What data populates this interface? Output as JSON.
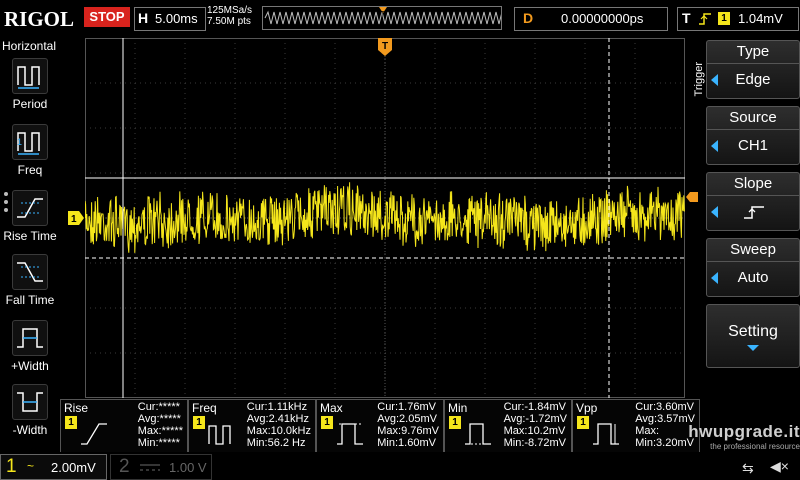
{
  "topbar": {
    "logo": "RIGOL",
    "run_state": "STOP",
    "horizontal_label": "H",
    "timebase": "5.00ms",
    "sample_rate": "125MSa/s",
    "memory_depth": "7.50M pts",
    "delay_label": "D",
    "delay_value": "0.00000000ps",
    "trigger_label": "T",
    "trigger_channel": "1",
    "trigger_level": "1.04mV"
  },
  "left_menu": {
    "title": "Horizontal",
    "items": [
      {
        "label": "Period",
        "icon": "period-icon"
      },
      {
        "label": "Freq",
        "icon": "freq-icon"
      },
      {
        "label": "Rise Time",
        "icon": "rise-time-icon"
      },
      {
        "label": "Fall Time",
        "icon": "fall-time-icon"
      },
      {
        "label": "+Width",
        "icon": "positive-width-icon"
      },
      {
        "label": "-Width",
        "icon": "negative-width-icon"
      }
    ]
  },
  "right_menu": {
    "title": "Trigger",
    "buttons": [
      {
        "title": "Type",
        "value": "Edge"
      },
      {
        "title": "Source",
        "value": "CH1"
      },
      {
        "title": "Slope",
        "value": ""
      },
      {
        "title": "Sweep",
        "value": "Auto"
      }
    ],
    "setting": "Setting"
  },
  "waveform": {
    "channel_marker": "1",
    "trigger_marker": "T",
    "color": "#f5e61b"
  },
  "measurements": [
    {
      "name": "Rise",
      "badge": "1",
      "cur": "Cur:*****",
      "avg": "Avg:*****",
      "max": "Max:*****",
      "min": "Min:*****"
    },
    {
      "name": "Freq",
      "badge": "1",
      "cur": "Cur:1.11kHz",
      "avg": "Avg:2.41kHz",
      "max": "Max:10.0kHz",
      "min": "Min:56.2 Hz"
    },
    {
      "name": "Max",
      "badge": "1",
      "cur": "Cur:1.76mV",
      "avg": "Avg:2.05mV",
      "max": "Max:9.76mV",
      "min": "Min:1.60mV"
    },
    {
      "name": "Min",
      "badge": "1",
      "cur": "Cur:-1.84mV",
      "avg": "Avg:-1.72mV",
      "max": "Max:10.2mV",
      "min": "Min:-8.72mV"
    },
    {
      "name": "Vpp",
      "badge": "1",
      "cur": "Cur:3.60mV",
      "avg": "Avg:3.57mV",
      "max": "Max:",
      "min": "Min:3.20mV"
    }
  ],
  "channels": {
    "ch1": {
      "number": "1",
      "coupling": "~",
      "scale": "2.00mV"
    },
    "ch2": {
      "number": "2",
      "coupling": "",
      "scale": "1.00 V"
    }
  },
  "watermark": {
    "line1": "hwupgrade.it",
    "line2": "the professional resource"
  }
}
